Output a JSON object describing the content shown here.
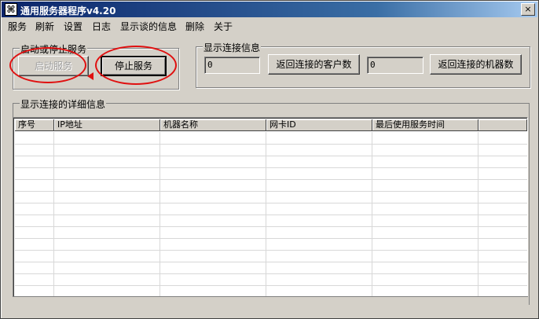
{
  "window": {
    "title": "通用服务器程序v4.20",
    "icon": "app-logo-icon",
    "close_label": "×"
  },
  "menu": [
    "服务",
    "刷新",
    "设置",
    "日志",
    "显示谈的信息",
    "删除",
    "关于"
  ],
  "service_group": {
    "legend": "启动或停止服务",
    "start_label": "启动服务",
    "stop_label": "停止服务"
  },
  "connection_group": {
    "legend": "显示连接信息",
    "client_count": "0",
    "client_button": "返回连接的客户数",
    "machine_count": "0",
    "machine_button": "返回连接的机器数"
  },
  "details_group": {
    "legend": "显示连接的详细信息",
    "columns": [
      "序号",
      "IP地址",
      "机器名称",
      "网卡ID",
      "最后使用服务时间",
      ""
    ]
  },
  "annotation": {
    "color": "#e01010"
  }
}
